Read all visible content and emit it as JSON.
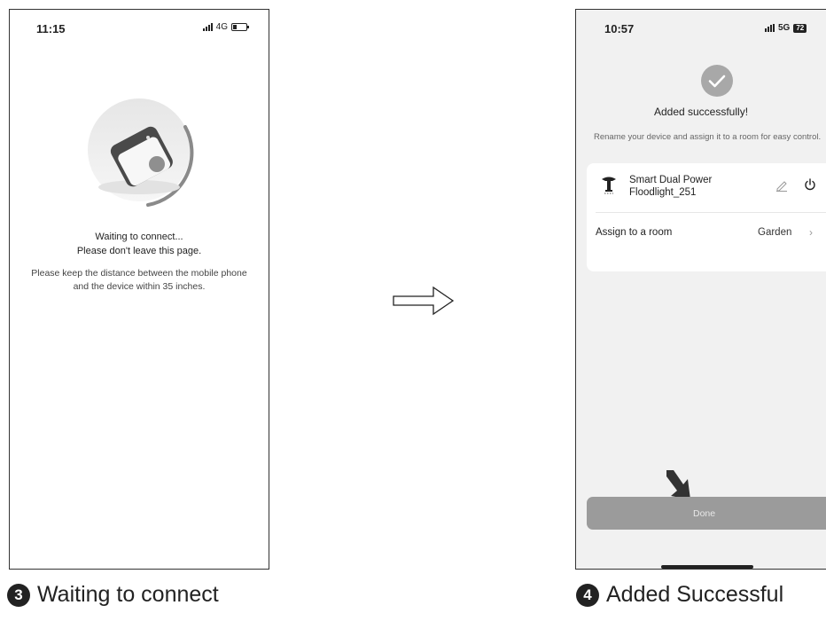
{
  "left_screen": {
    "status": {
      "time": "11:15",
      "network": "4G"
    },
    "waiting_title": "Waiting to connect...",
    "waiting_sub": "Please don't leave this page.",
    "hint": "Please keep the distance between the mobile phone and the device within 35 inches."
  },
  "right_screen": {
    "status": {
      "time": "10:57",
      "network": "5G",
      "battery": "72"
    },
    "added_title": "Added successfully!",
    "rename_hint": "Rename your device and assign it to a room for easy control.",
    "device": {
      "name_line1": "Smart Dual Power",
      "name_line2": "Floodlight_251"
    },
    "assign_label": "Assign to a room",
    "assign_value": "Garden",
    "done_label": "Done"
  },
  "captions": {
    "left": {
      "num": "3",
      "text": "Waiting to connect"
    },
    "right": {
      "num": "4",
      "text": "Added Successful"
    }
  }
}
